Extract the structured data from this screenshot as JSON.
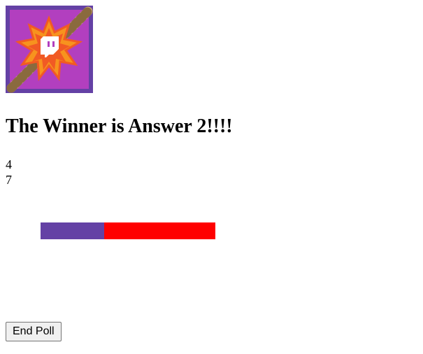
{
  "logo": {
    "icon": "twitch-rope-burst-logo",
    "background_color": "#6441a5",
    "inner_color": "#b23fbf",
    "burst_color": "#f15a24"
  },
  "result": {
    "winner_text": "The Winner is Answer 2!!!!"
  },
  "counts": [
    "4",
    "7"
  ],
  "bar": {
    "segments": [
      {
        "value": 4,
        "color": "#6441a5"
      },
      {
        "value": 7,
        "color": "#ff0000"
      }
    ]
  },
  "controls": {
    "end_poll_label": "End Poll"
  }
}
